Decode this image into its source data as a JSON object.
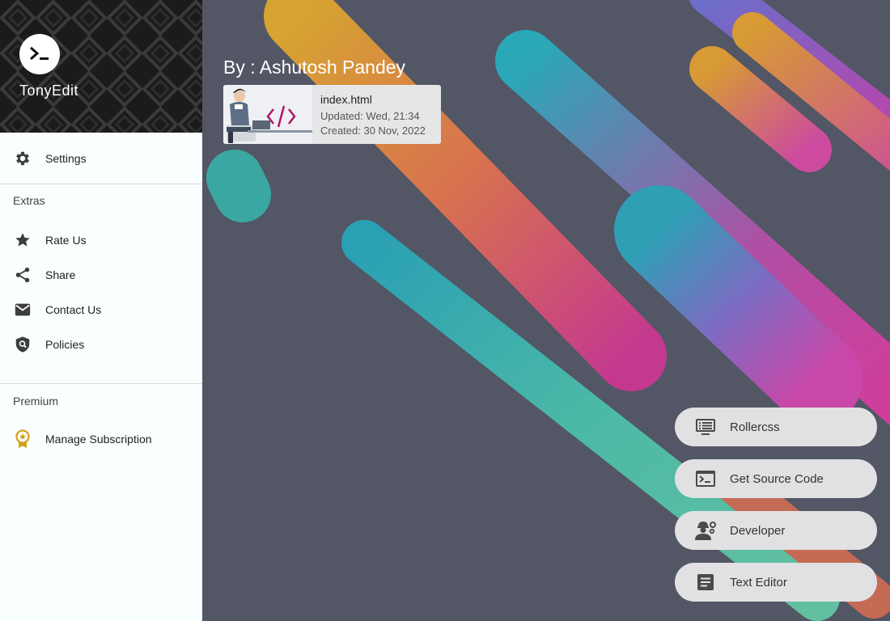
{
  "app": {
    "title": "TonyEdit"
  },
  "drawer": {
    "settings_label": "Settings",
    "extras_title": "Extras",
    "extras": [
      {
        "label": "Rate Us",
        "icon": "star-icon"
      },
      {
        "label": "Share",
        "icon": "share-icon"
      },
      {
        "label": "Contact Us",
        "icon": "mail-icon"
      },
      {
        "label": "Policies",
        "icon": "policy-icon"
      }
    ],
    "premium_title": "Premium",
    "premium": [
      {
        "label": "Manage Subscription",
        "icon": "premium-badge-icon"
      }
    ]
  },
  "main": {
    "author": "By : Ashutosh Pandey",
    "file": {
      "name": "index.html",
      "updated": "Updated: Wed, 21:34",
      "created": "Created: 30 Nov, 2022"
    },
    "actions": [
      {
        "label": "Rollercss",
        "icon": "monitor-list-icon"
      },
      {
        "label": "Get Source Code",
        "icon": "terminal-icon"
      },
      {
        "label": "Developer",
        "icon": "engineer-icon"
      },
      {
        "label": "Text Editor",
        "icon": "article-icon"
      }
    ]
  },
  "colors": {
    "drawer_bg": "#f9fffe",
    "main_bg": "#525665",
    "button_bg": "#e1e1e3",
    "premium_gold": "#d4a017",
    "code_accent": "#b0176a"
  }
}
